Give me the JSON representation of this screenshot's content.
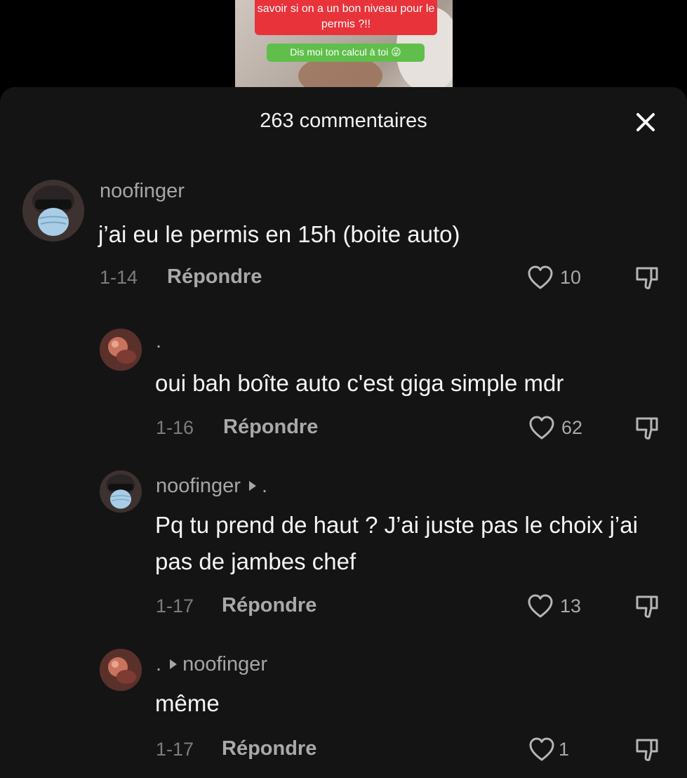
{
  "video_preview": {
    "caption_red": "savoir si on a un bon niveau pour le permis ?!!",
    "caption_green": "Dis moi ton calcul à toi 😜"
  },
  "sheet": {
    "title": "263 commentaires",
    "close_icon": "close-icon"
  },
  "comments": [
    {
      "username": "noofinger",
      "text": "j’ai eu le permis en 15h (boite auto)",
      "date": "1-14",
      "reply_label": "Répondre",
      "likes": "10"
    },
    {
      "username": ".",
      "text": "oui bah boîte auto c'est giga simple mdr",
      "date": "1-16",
      "reply_label": "Répondre",
      "likes": "62"
    },
    {
      "username": "noofinger",
      "reply_to": ".",
      "text": "Pq tu prend de haut ? J’ai juste pas le choix j’ai pas de jambes chef",
      "date": "1-17",
      "reply_label": "Répondre",
      "likes": "13"
    },
    {
      "username": ".",
      "reply_to": "noofinger",
      "text": "même",
      "date": "1-17",
      "reply_label": "Répondre",
      "likes": "1"
    }
  ],
  "colors": {
    "sheet_background": "#141414",
    "text_primary": "#f5f5f5",
    "text_secondary": "#a6a6a6",
    "caption_red": "#e8333b",
    "caption_green": "#5fbf4a"
  }
}
